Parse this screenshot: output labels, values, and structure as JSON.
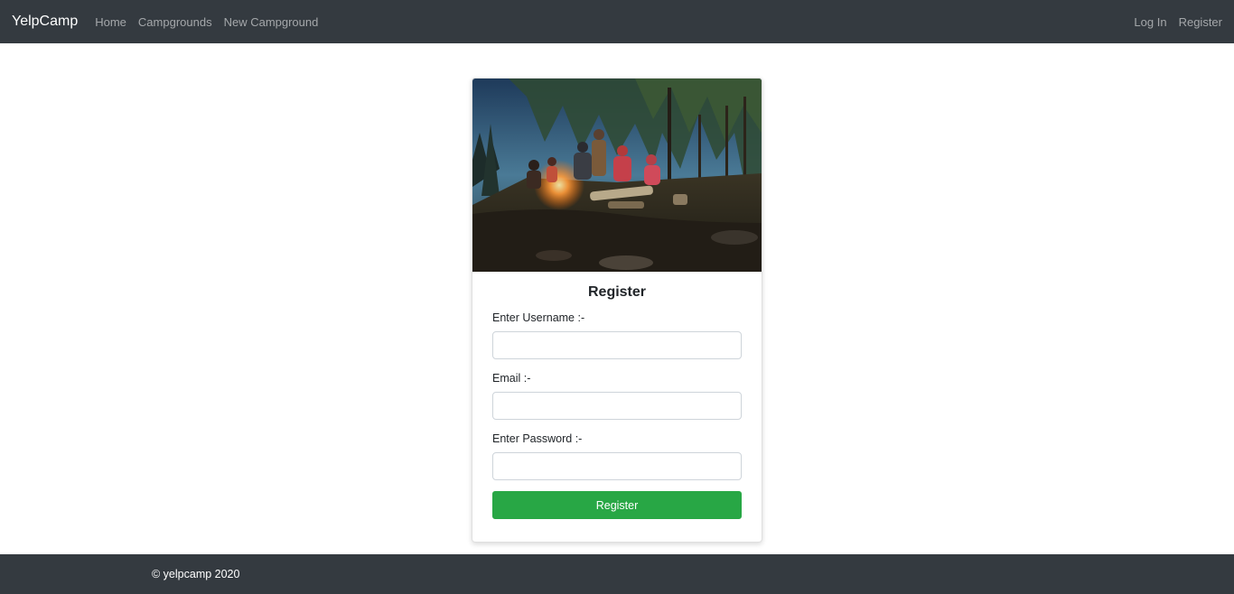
{
  "navbar": {
    "brand": "YelpCamp",
    "links": [
      "Home",
      "Campgrounds",
      "New Campground"
    ],
    "right_links": [
      "Log In",
      "Register"
    ]
  },
  "card": {
    "image_alt": "campfire at night in forest",
    "title": "Register",
    "fields": {
      "username": {
        "label": "Enter Username :-",
        "value": ""
      },
      "email": {
        "label": "Email :-",
        "value": ""
      },
      "password": {
        "label": "Enter Password :-",
        "value": ""
      }
    },
    "submit_label": "Register"
  },
  "footer": {
    "text": "© yelpcamp 2020"
  },
  "colors": {
    "navbar_bg": "#343a40",
    "button_green": "#28a745",
    "footer_bg": "#343a40"
  }
}
